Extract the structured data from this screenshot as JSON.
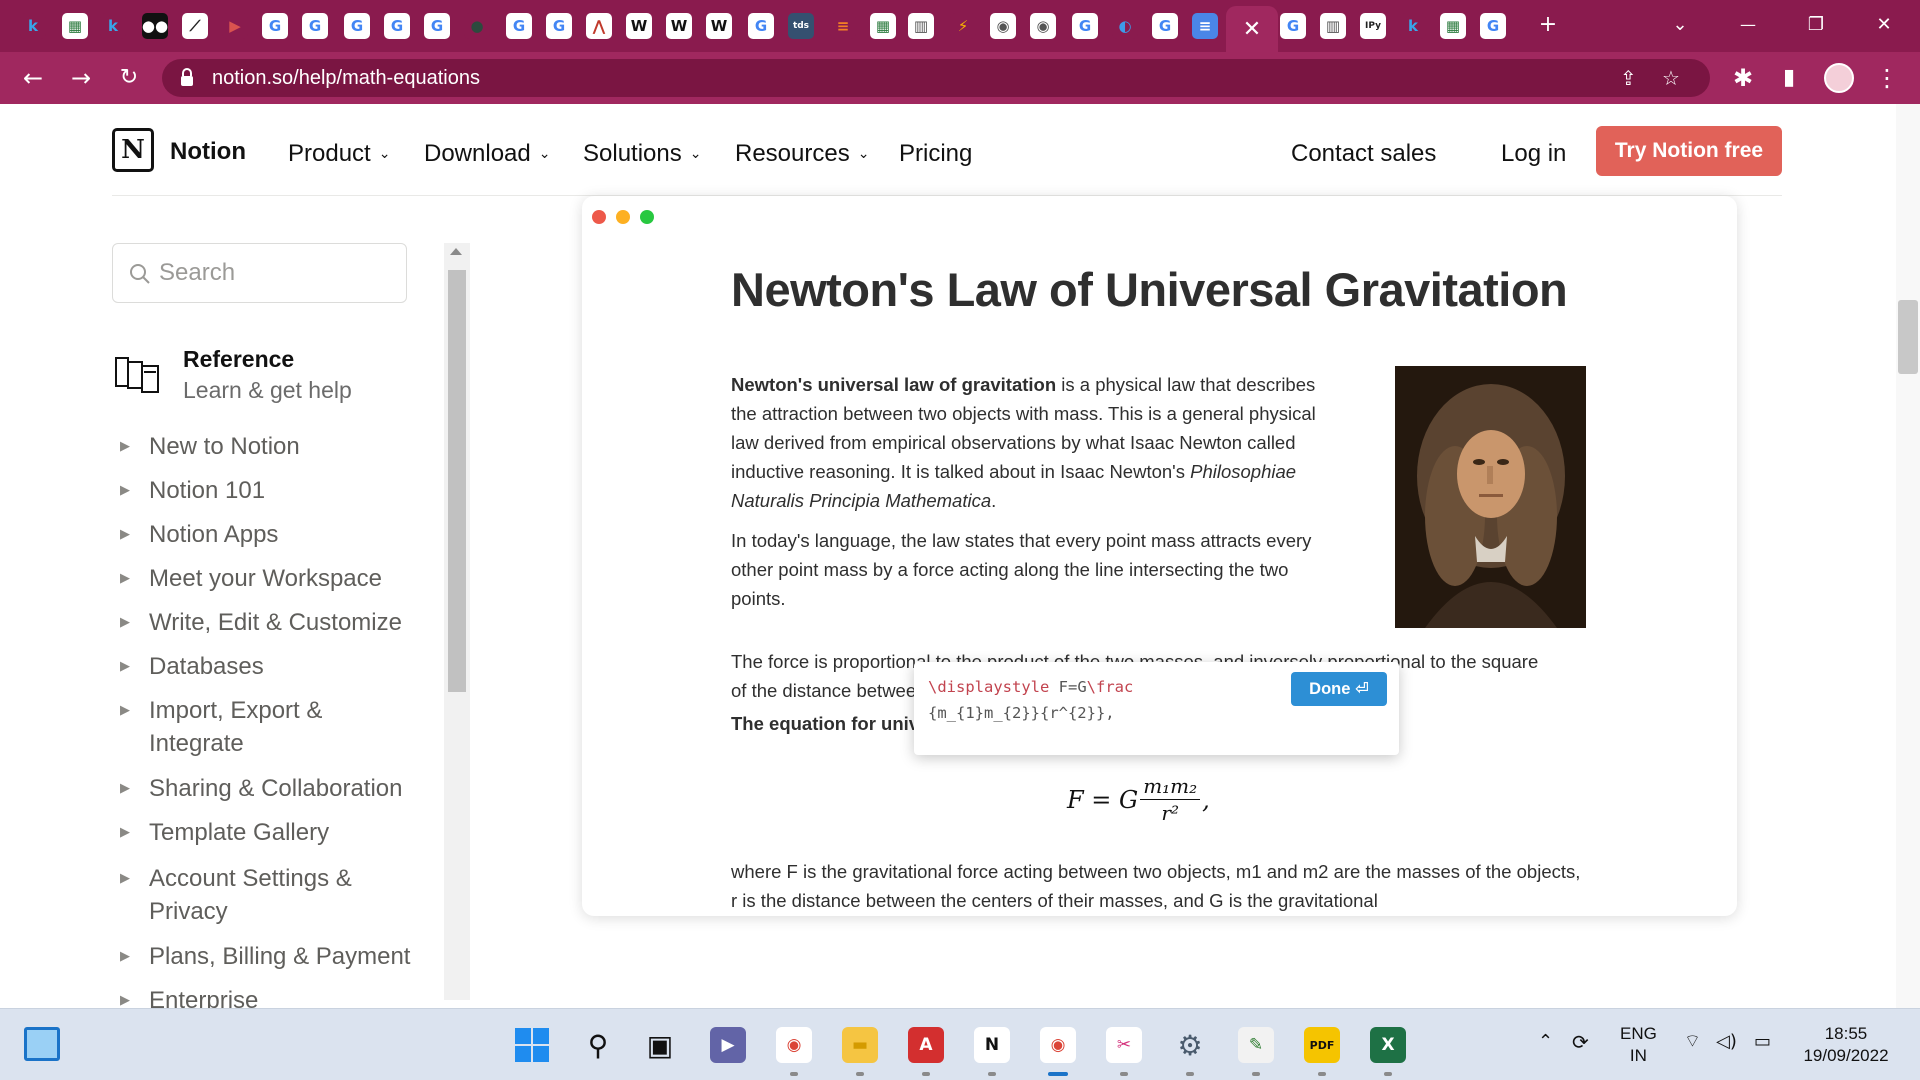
{
  "browser": {
    "url": "notion.so/help/math-equations",
    "tab_icons": [
      {
        "icon": "k-icon",
        "glyph": "k",
        "bg": "#8a1b4e",
        "fg": "#39a6e8"
      },
      {
        "icon": "sheet-icon",
        "glyph": "▦",
        "bg": "#ffffff",
        "fg": "#2b7a3d"
      },
      {
        "icon": "k-icon",
        "glyph": "k",
        "bg": "#8a1b4e",
        "fg": "#39a6e8"
      },
      {
        "icon": "medium-icon",
        "glyph": "●●",
        "bg": "#111111",
        "fg": "#ffffff"
      },
      {
        "icon": "chart-icon",
        "glyph": "⟋",
        "bg": "#ffffff",
        "fg": "#222222"
      },
      {
        "icon": "slides-icon",
        "glyph": "▶",
        "bg": "#8a1b4e",
        "fg": "#d9534f"
      },
      {
        "icon": "google-icon",
        "glyph": "G",
        "bg": "#ffffff",
        "fg": "#4285f4"
      },
      {
        "icon": "google-icon",
        "glyph": "G",
        "bg": "#ffffff",
        "fg": "#4285f4"
      },
      {
        "icon": "google-icon",
        "glyph": "G",
        "bg": "#ffffff",
        "fg": "#4285f4"
      },
      {
        "icon": "google-icon",
        "glyph": "G",
        "bg": "#ffffff",
        "fg": "#4285f4"
      },
      {
        "icon": "google-icon",
        "glyph": "G",
        "bg": "#ffffff",
        "fg": "#4285f4"
      },
      {
        "icon": "globe-icon",
        "glyph": "●",
        "bg": "#8a1b4e",
        "fg": "#2c4a3e"
      },
      {
        "icon": "google-icon",
        "glyph": "G",
        "bg": "#ffffff",
        "fg": "#4285f4"
      },
      {
        "icon": "google-icon",
        "glyph": "G",
        "bg": "#ffffff",
        "fg": "#4285f4"
      },
      {
        "icon": "graph-icon",
        "glyph": "⋀",
        "bg": "#ffffff",
        "fg": "#c0392b"
      },
      {
        "icon": "wikipedia-icon",
        "glyph": "W",
        "bg": "#ffffff",
        "fg": "#111111"
      },
      {
        "icon": "wikipedia-icon",
        "glyph": "W",
        "bg": "#ffffff",
        "fg": "#111111"
      },
      {
        "icon": "wikipedia-icon",
        "glyph": "W",
        "bg": "#ffffff",
        "fg": "#111111"
      },
      {
        "icon": "google-icon",
        "glyph": "G",
        "bg": "#ffffff",
        "fg": "#4285f4"
      },
      {
        "icon": "tds-icon",
        "glyph": "tds",
        "bg": "#355070",
        "fg": "#ffffff"
      },
      {
        "icon": "stack-icon",
        "glyph": "≡",
        "bg": "#8a1b4e",
        "fg": "#f48024"
      },
      {
        "icon": "sheet-icon",
        "glyph": "▦",
        "bg": "#ffffff",
        "fg": "#2b7a3d"
      },
      {
        "icon": "reader-icon",
        "glyph": "▥",
        "bg": "#ffffff",
        "fg": "#555555"
      },
      {
        "icon": "bolt-icon",
        "glyph": "⚡",
        "bg": "#8a1b4e",
        "fg": "#f7b500"
      },
      {
        "icon": "chrome-icon",
        "glyph": "◉",
        "bg": "#ffffff",
        "fg": "#555555"
      },
      {
        "icon": "chrome-icon",
        "glyph": "◉",
        "bg": "#ffffff",
        "fg": "#555555"
      },
      {
        "icon": "google-icon",
        "glyph": "G",
        "bg": "#ffffff",
        "fg": "#4285f4"
      },
      {
        "icon": "edge-icon",
        "glyph": "◐",
        "bg": "#8a1b4e",
        "fg": "#3d9be9"
      },
      {
        "icon": "google-icon",
        "glyph": "G",
        "bg": "#ffffff",
        "fg": "#4285f4"
      },
      {
        "icon": "docs-icon",
        "glyph": "≡",
        "bg": "#4a86e8",
        "fg": "#ffffff"
      },
      {
        "icon": "google-icon",
        "glyph": "G",
        "bg": "#ffffff",
        "fg": "#4285f4"
      },
      {
        "icon": "reader-icon",
        "glyph": "▥",
        "bg": "#ffffff",
        "fg": "#555555"
      },
      {
        "icon": "ipython-icon",
        "glyph": "IPy",
        "bg": "#ffffff",
        "fg": "#222222"
      },
      {
        "icon": "k-icon",
        "glyph": "k",
        "bg": "#8a1b4e",
        "fg": "#39a6e8"
      },
      {
        "icon": "sheet-icon",
        "glyph": "▦",
        "bg": "#ffffff",
        "fg": "#2b7a3d"
      },
      {
        "icon": "google-icon",
        "glyph": "G",
        "bg": "#ffffff",
        "fg": "#4285f4"
      }
    ],
    "active_tab_close": "✕",
    "new_tab": "+",
    "controls": {
      "dropdown": "⌄",
      "minimize": "—",
      "restore": "❐",
      "close": "✕"
    }
  },
  "header": {
    "logo_text": "Notion",
    "nav": [
      {
        "label": "Product",
        "has_chevron": true
      },
      {
        "label": "Download",
        "has_chevron": true
      },
      {
        "label": "Solutions",
        "has_chevron": true
      },
      {
        "label": "Resources",
        "has_chevron": true
      },
      {
        "label": "Pricing",
        "has_chevron": false
      }
    ],
    "contact_sales": "Contact sales",
    "log_in": "Log in",
    "cta": "Try Notion free",
    "cta_color": "#e16259"
  },
  "sidebar": {
    "search_placeholder": "Search",
    "reference_title": "Reference",
    "reference_subtitle": "Learn & get help",
    "items": [
      {
        "label": "New to Notion"
      },
      {
        "label": "Notion 101"
      },
      {
        "label": "Notion Apps"
      },
      {
        "label": "Meet your Workspace"
      },
      {
        "label": "Write, Edit & Customize"
      },
      {
        "label": "Databases"
      },
      {
        "label": "Import, Export & Integrate"
      },
      {
        "label": "Sharing & Collaboration"
      },
      {
        "label": "Template Gallery"
      },
      {
        "label": "Account Settings & Privacy"
      },
      {
        "label": "Plans, Billing & Payment"
      },
      {
        "label": "Enterprise"
      }
    ]
  },
  "article": {
    "title": "Newton's Law of Universal Gravitation",
    "p1_bold": "Newton's universal law of gravitation",
    "p1_rest": " is a physical law that describes the attraction between two objects with mass. This is a general physical law derived from empirical observations by what Isaac Newton called inductive reasoning. It is talked about in Isaac Newton's ",
    "p1_italic": "Philosophiae Naturalis Principia Mathematica",
    "p1_end": ".",
    "p2": "In today's language, the law states that every point mass attracts every other point mass by a force acting along the line intersecting the two points.",
    "p3": "The force is proportional to the product of the two masses, and inversely proportional to the square of the distance between them.",
    "p4_bold": "The equation for universal gravitation thus takes the form:",
    "equation": {
      "lhs": "F = G",
      "num": "m₁m₂",
      "den": "r²",
      "trail": ","
    },
    "p5": "where F is the gravitational force acting between two objects, m1 and m2 are the masses of the objects, r is the distance between the centers of their masses, and G is the gravitational"
  },
  "equation_editor": {
    "code_line1_kw1": "\\displaystyle",
    "code_line1_mid": " F=G",
    "code_line1_kw2": "\\frac",
    "code_line2": "{m_{1}m_{2}}{r^{2}},",
    "done_label": "Done",
    "done_icon": "⏎"
  },
  "taskbar": {
    "apps": [
      {
        "icon": "search-icon",
        "glyph": "⚲",
        "bg": "transparent",
        "fg": "#111111"
      },
      {
        "icon": "task-view-icon",
        "glyph": "▣",
        "bg": "transparent",
        "fg": "#111111"
      },
      {
        "icon": "teams-icon",
        "glyph": "▶",
        "bg": "#6264a7",
        "fg": "#ffffff"
      },
      {
        "icon": "chrome-icon",
        "glyph": "◉",
        "bg": "#ffffff",
        "fg": "#db4437"
      },
      {
        "icon": "file-explorer-icon",
        "glyph": "▬",
        "bg": "#f5c542",
        "fg": "#d49b00"
      },
      {
        "icon": "acrobat-icon",
        "glyph": "A",
        "bg": "#d32f2f",
        "fg": "#ffffff"
      },
      {
        "icon": "notion-icon",
        "glyph": "N",
        "bg": "#ffffff",
        "fg": "#111111"
      },
      {
        "icon": "chrome-icon",
        "glyph": "◉",
        "bg": "#ffffff",
        "fg": "#db4437"
      },
      {
        "icon": "snipping-tool-icon",
        "glyph": "✂",
        "bg": "#ffffff",
        "fg": "#d4317b"
      },
      {
        "icon": "settings-icon",
        "glyph": "⚙",
        "bg": "transparent",
        "fg": "#4a5b6d"
      },
      {
        "icon": "notepad-icon",
        "glyph": "✎",
        "bg": "#f2f2f2",
        "fg": "#2f7d32"
      },
      {
        "icon": "pdf-icon",
        "glyph": "PDF",
        "bg": "#f5c400",
        "fg": "#111111"
      },
      {
        "icon": "excel-icon",
        "glyph": "X",
        "bg": "#1e7145",
        "fg": "#ffffff"
      }
    ],
    "lang_line1": "ENG",
    "lang_line2": "IN",
    "time": "18:55",
    "date": "19/09/2022"
  }
}
